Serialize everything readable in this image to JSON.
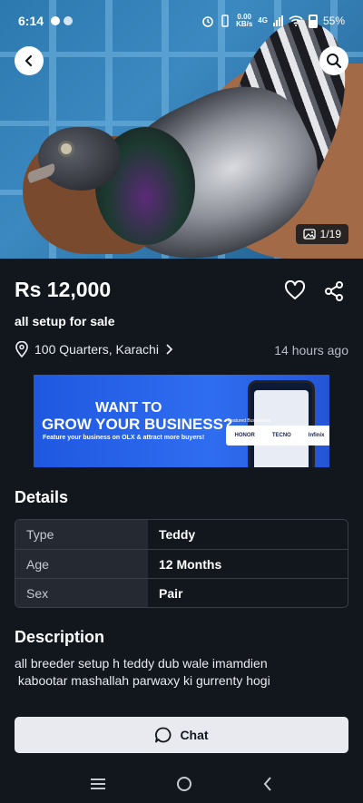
{
  "status_bar": {
    "time": "6:14",
    "net_speed_value": "0.00",
    "net_speed_unit": "KB/s",
    "network_type": "4G",
    "battery": "55%"
  },
  "gallery": {
    "counter": "1/19"
  },
  "listing": {
    "price": "Rs 12,000",
    "title": "all setup for sale",
    "location": "100 Quarters, Karachi",
    "posted": "14 hours ago"
  },
  "banner": {
    "line1": "WANT TO",
    "line2": "GROW YOUR BUSINESS?",
    "line3": "Feature your business on OLX & attract more buyers!",
    "tag": "Featured Businesses",
    "brands": [
      "HONOR",
      "TECNO",
      "Infinix"
    ]
  },
  "details": {
    "title": "Details",
    "rows": [
      {
        "key": "Type",
        "value": "Teddy"
      },
      {
        "key": "Age",
        "value": "12 Months"
      },
      {
        "key": "Sex",
        "value": "Pair"
      }
    ]
  },
  "description": {
    "title": "Description",
    "line1": "all breeder setup h teddy dub wale imamdien",
    "line2": " kabootar mashallah parwaxy ki gurrenty hogi"
  },
  "chat": {
    "label": "Chat"
  },
  "icons": {
    "back": "arrow-left-icon",
    "search": "search-icon",
    "favorite": "heart-icon",
    "share": "share-icon",
    "location": "location-pin-icon",
    "chat": "chat-bubble-icon",
    "gallery": "image-icon"
  },
  "colors": {
    "background": "#12161d",
    "table_key_bg": "#252a32",
    "chat_button_bg": "#e8eaf0",
    "banner_blue": "#2f6df0"
  }
}
